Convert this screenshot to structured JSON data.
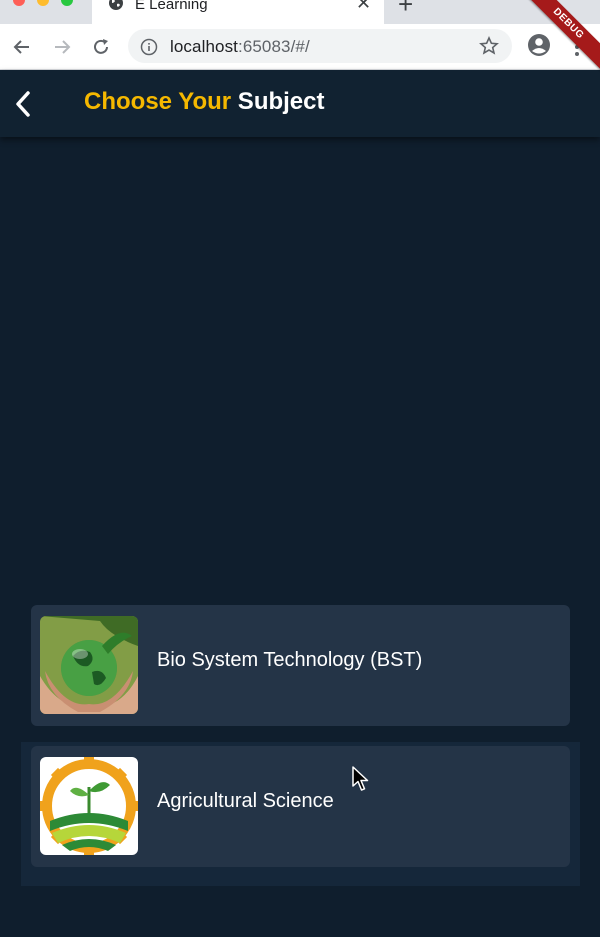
{
  "browser": {
    "tab_title": "E Learning",
    "tab_icon": "globe-icon",
    "url_host": "localhost",
    "url_rest": ":65083/#/"
  },
  "appbar": {
    "title_accent": "Choose Your",
    "title_rest": " Subject",
    "debug_label": "DEBUG"
  },
  "subjects": [
    {
      "label": "Bio System Technology (BST)",
      "icon": "earth-in-hands-icon"
    },
    {
      "label": "Agricultural Science",
      "icon": "agriculture-gear-icon"
    }
  ],
  "colors": {
    "background": "#0f1e2d",
    "card": "#243447",
    "accent": "#f5b800",
    "debug": "#a51a1a"
  }
}
